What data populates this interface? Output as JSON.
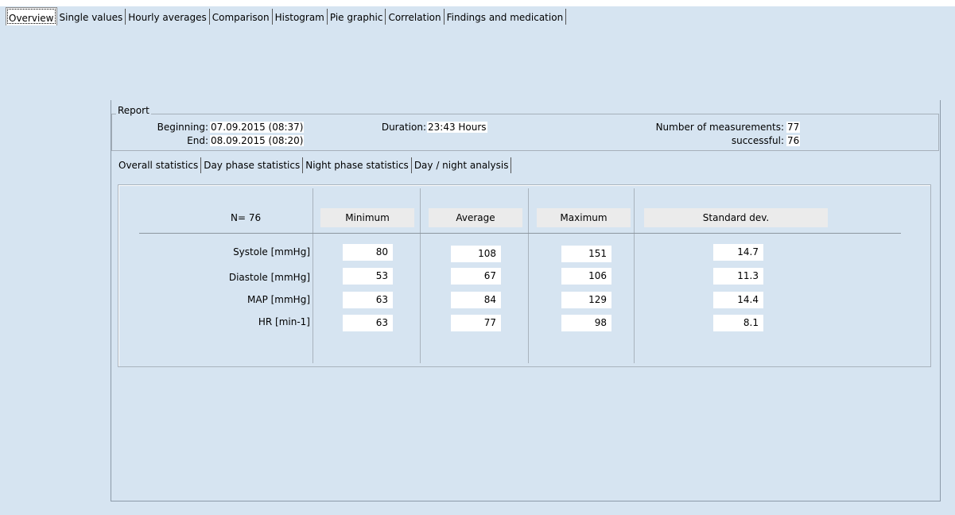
{
  "main_tabs": [
    {
      "label": "Overview",
      "active": true
    },
    {
      "label": "Single values",
      "active": false
    },
    {
      "label": "Hourly averages",
      "active": false
    },
    {
      "label": "Comparison",
      "active": false
    },
    {
      "label": "Histogram",
      "active": false
    },
    {
      "label": "Pie graphic",
      "active": false
    },
    {
      "label": "Correlation",
      "active": false
    },
    {
      "label": "Findings and medication",
      "active": false
    }
  ],
  "report": {
    "legend": "Report",
    "beginning_label": "Beginning:",
    "beginning_value": "07.09.2015  (08:37)",
    "end_label": "End:",
    "end_value": "08.09.2015  (08:20)",
    "duration_label": "Duration:",
    "duration_value": "23:43 Hours",
    "num_measurements_label": "Number of measurements:",
    "num_measurements_value": "77",
    "successful_label": "successful:",
    "successful_value": "76"
  },
  "sub_tabs": [
    {
      "label": "Overall statistics",
      "active": true
    },
    {
      "label": "Day phase statistics",
      "active": false
    },
    {
      "label": "Night phase statistics",
      "active": false
    },
    {
      "label": "Day / night analysis",
      "active": false
    }
  ],
  "stats": {
    "n_label": "N= 76",
    "columns": [
      "Minimum",
      "Average",
      "Maximum",
      "Standard dev."
    ],
    "rows": [
      {
        "label": "Systole [mmHg]",
        "values": [
          "80",
          "108",
          "151",
          "14.7"
        ]
      },
      {
        "label": "Diastole [mmHg]",
        "values": [
          "53",
          "67",
          "106",
          "11.3"
        ]
      },
      {
        "label": "MAP [mmHg]",
        "values": [
          "63",
          "84",
          "129",
          "14.4"
        ]
      },
      {
        "label": "HR [min-1]",
        "values": [
          "63",
          "77",
          "98",
          "8.1"
        ]
      }
    ]
  },
  "colors": {
    "background": "#d6e4f1",
    "header_cell": "#ebebeb",
    "value_cell": "#ffffff"
  }
}
